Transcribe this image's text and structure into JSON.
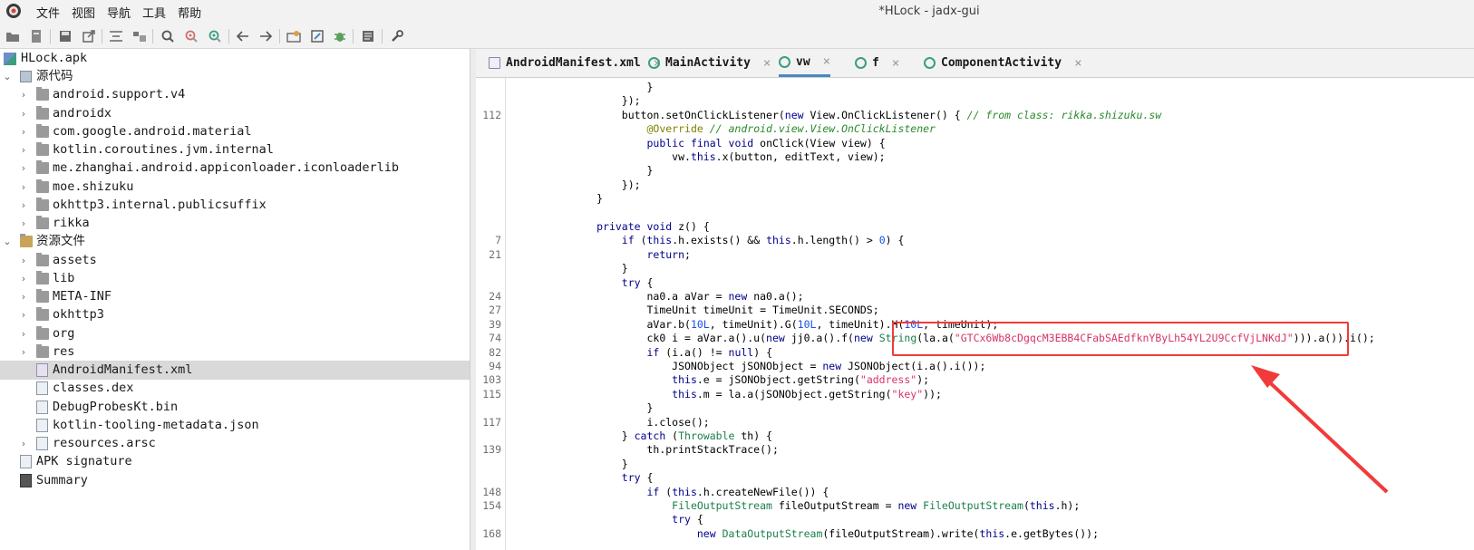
{
  "window": {
    "title": "*HLock - jadx-gui",
    "menu": [
      "文件",
      "视图",
      "导航",
      "工具",
      "帮助"
    ]
  },
  "toolbar": {
    "icons": [
      "open-icon",
      "add-file-icon",
      "save-icon",
      "export-icon",
      "sync-icon",
      "flatten-icon",
      "search-icon",
      "find-usage-icon",
      "find-class-icon",
      "back-icon",
      "forward-icon",
      "deobfuscation-icon",
      "decompile-icon",
      "debug-icon",
      "log-icon",
      "preferences-icon"
    ]
  },
  "tree": {
    "root": "HLock.apk",
    "source_code": "源代码",
    "packages": [
      "android.support.v4",
      "androidx",
      "com.google.android.material",
      "kotlin.coroutines.jvm.internal",
      "me.zhanghai.android.appiconloader.iconloaderlib",
      "moe.shizuku",
      "okhttp3.internal.publicsuffix",
      "rikka"
    ],
    "resources": "资源文件",
    "resource_folders": [
      "assets",
      "lib",
      "META-INF",
      "okhttp3",
      "org",
      "res"
    ],
    "resource_files": [
      "AndroidManifest.xml",
      "classes.dex",
      "DebugProbesKt.bin",
      "kotlin-tooling-metadata.json",
      "resources.arsc"
    ],
    "apk_signature": "APK signature",
    "summary": "Summary",
    "selected": "AndroidManifest.xml"
  },
  "tabs": [
    {
      "label": "AndroidManifest.xml",
      "icon": "manifest-icon",
      "active": false
    },
    {
      "label": "MainActivity",
      "icon": "class-icon",
      "active": false
    },
    {
      "label": "vw",
      "icon": "class-icon",
      "active": true
    },
    {
      "label": "f",
      "icon": "class-icon",
      "active": false
    },
    {
      "label": "ComponentActivity",
      "icon": "class-icon",
      "active": false
    }
  ],
  "code_lines": [
    {
      "ln": "",
      "text": "                    }"
    },
    {
      "ln": "",
      "text": "                });"
    },
    {
      "ln": "112",
      "text": "                button.setOnClickListener(new View.OnClickListener() { // from class: rikka.shizuku.sw"
    },
    {
      "ln": "",
      "text": "                    @Override // android.view.View.OnClickListener"
    },
    {
      "ln": "",
      "text": "                    public final void onClick(View view) {"
    },
    {
      "ln": "",
      "text": "                        vw.this.x(button, editText, view);"
    },
    {
      "ln": "",
      "text": "                    }"
    },
    {
      "ln": "",
      "text": "                });"
    },
    {
      "ln": "",
      "text": "            }"
    },
    {
      "ln": "",
      "text": ""
    },
    {
      "ln": "",
      "text": "            private void z() {"
    },
    {
      "ln": "7",
      "text": "                if (this.h.exists() && this.h.length() > 0) {"
    },
    {
      "ln": "21",
      "text": "                    return;"
    },
    {
      "ln": "",
      "text": "                }"
    },
    {
      "ln": "",
      "text": "                try {"
    },
    {
      "ln": "24",
      "text": "                    na0.a aVar = new na0.a();"
    },
    {
      "ln": "27",
      "text": "                    TimeUnit timeUnit = TimeUnit.SECONDS;"
    },
    {
      "ln": "39",
      "text": "                    aVar.b(10L, timeUnit).G(10L, timeUnit).H(10L, timeUnit);"
    },
    {
      "ln": "74",
      "text": "                    ck0 i = aVar.a().u(new jj0.a().f(new String(la.a(\"GTCx6Wb8cDgqcM3EBB4CFabSAEdfknYByLh54YL2U9CcfVjLNKdJ\"))).a()).i();"
    },
    {
      "ln": "82",
      "text": "                    if (i.a() != null) {"
    },
    {
      "ln": "94",
      "text": "                        JSONObject jSONObject = new JSONObject(i.a().i());"
    },
    {
      "ln": "103",
      "text": "                        this.e = jSONObject.getString(\"address\");"
    },
    {
      "ln": "115",
      "text": "                        this.m = la.a(jSONObject.getString(\"key\"));"
    },
    {
      "ln": "",
      "text": "                    }"
    },
    {
      "ln": "117",
      "text": "                    i.close();"
    },
    {
      "ln": "",
      "text": "                } catch (Throwable th) {"
    },
    {
      "ln": "139",
      "text": "                    th.printStackTrace();"
    },
    {
      "ln": "",
      "text": "                }"
    },
    {
      "ln": "",
      "text": "                try {"
    },
    {
      "ln": "148",
      "text": "                    if (this.h.createNewFile()) {"
    },
    {
      "ln": "154",
      "text": "                        FileOutputStream fileOutputStream = new FileOutputStream(this.h);"
    },
    {
      "ln": "",
      "text": "                        try {"
    },
    {
      "ln": "168",
      "text": "                            new DataOutputStream(fileOutputStream).write(this.e.getBytes());"
    }
  ],
  "colors": {
    "highlight": "#f23a3a",
    "tab_active": "#4a88c7",
    "class_icon": "#3a9e83"
  }
}
